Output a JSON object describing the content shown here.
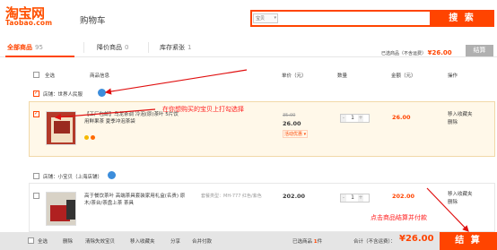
{
  "logo": {
    "cn": "淘宝网",
    "en": "Taobao.com"
  },
  "cart_title": "购物车",
  "search": {
    "type_label": "宝贝",
    "button_label": "搜 索",
    "value": ""
  },
  "tabs": [
    {
      "label": "全部商品",
      "count": "95"
    },
    {
      "label": "降价商品",
      "count": "0"
    },
    {
      "label": "库存紧张",
      "count": "1"
    }
  ],
  "summary_top": {
    "label": "已选商品（不含运费）",
    "amount": "¥26.00",
    "button": "结算"
  },
  "columns": {
    "select_all": "全选",
    "info": "商品信息",
    "unit_price": "单价（元）",
    "qty": "数量",
    "amount": "金额（元）",
    "ops": "操作"
  },
  "shops": [
    {
      "label": "店铺：",
      "name": "世界人民服",
      "items": [
        {
          "title": "【工厂包邮】乌龙茶调 冷泡(原)茶叶 5片饮用鲜果茶 夏季冲泡茶袋",
          "sku": "",
          "price_old": "35.00",
          "price_now": "26.00",
          "promo": "活动优惠 ▾",
          "qty": "1",
          "amount": "26.00",
          "ops": [
            "移入收藏夹",
            "删除"
          ]
        }
      ]
    },
    {
      "label": "店铺：",
      "name": "小宝贝（上海店铺）",
      "items": [
        {
          "title": "高于餐饮茶叶 高端茶具套装家用礼盒(名贵) 原木/茶台/茶盘上茶 茶具",
          "sku": "套餐类型：MH-777 红色/紫色",
          "price_old": "",
          "price_now": "202.00",
          "promo": "",
          "qty": "1",
          "amount": "202.00",
          "ops": [
            "移入收藏夹",
            "删除"
          ]
        }
      ]
    }
  ],
  "annotations": {
    "top": "在你想购买的宝贝上打勾选择",
    "bottom": "点击商品结算并付款"
  },
  "footer": {
    "select_all": "全选",
    "links": [
      "删除",
      "清除失效宝贝",
      "移入收藏夹",
      "分享",
      "合并付款"
    ],
    "selected_label": "已选商品",
    "selected_count": "1",
    "selected_unit": "件",
    "total_label": "合计（不含运费）：",
    "total_amount": "¥26.00",
    "settle": "结 算"
  },
  "colors": {
    "accent": "#ff4400",
    "brand": "#ff5000",
    "item_highlight": "#fff8e9"
  }
}
